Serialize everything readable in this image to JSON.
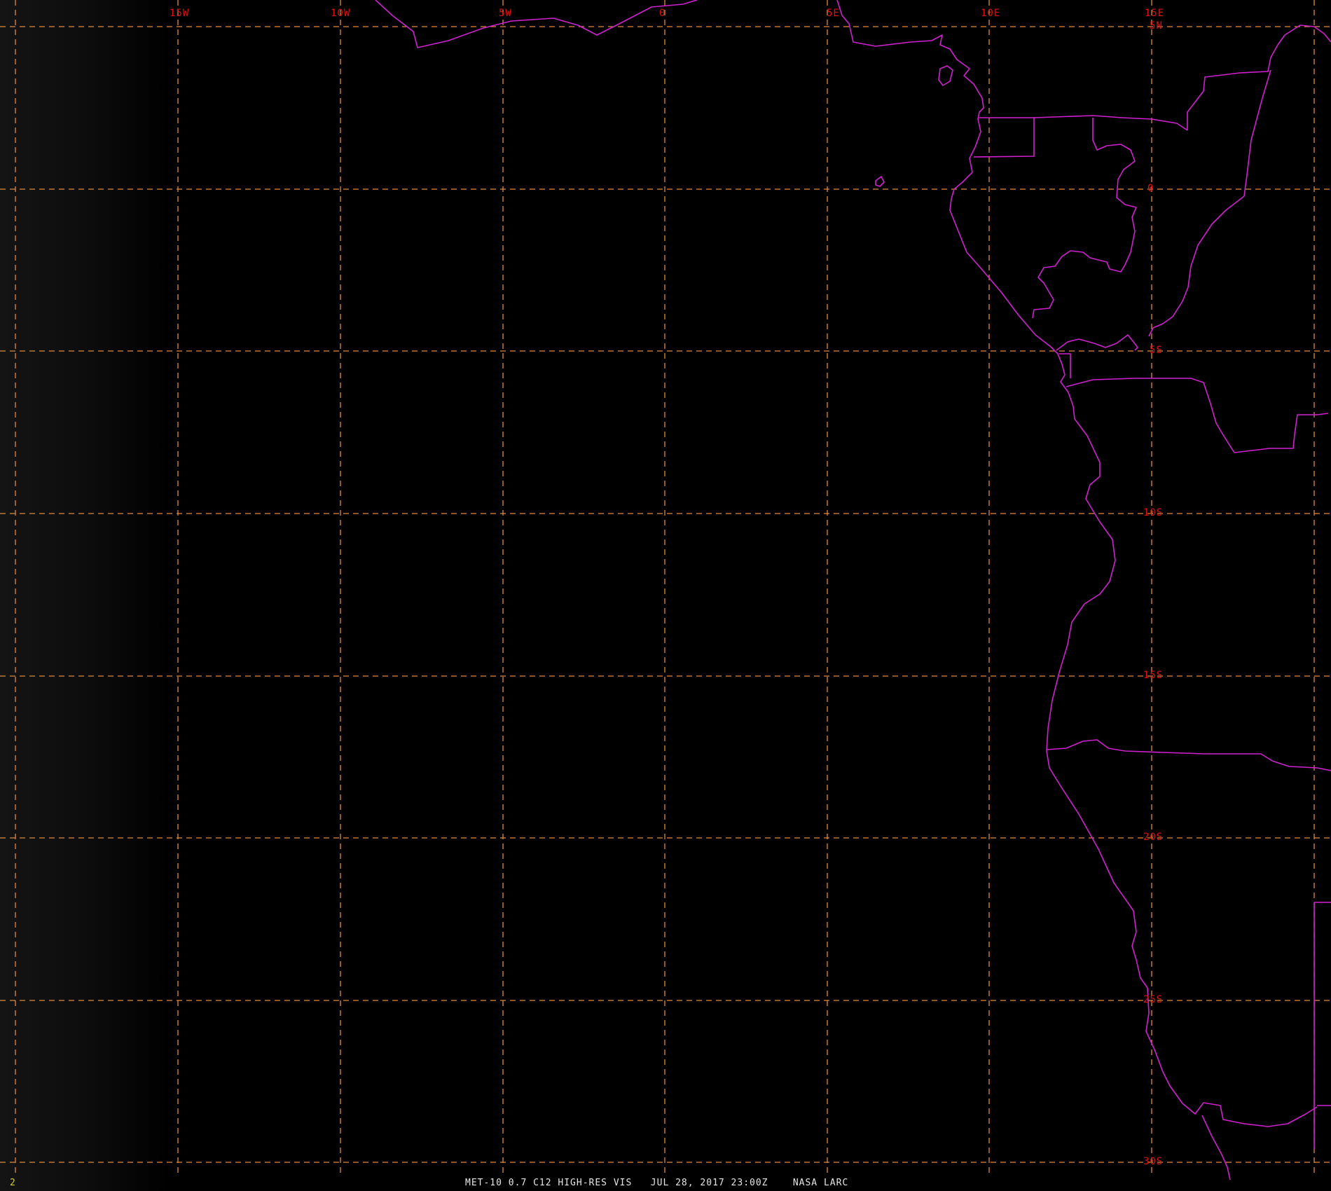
{
  "image": {
    "frame_number": "2",
    "caption": "MET-10 0.7 C12 HIGH-RES VIS   JUL 28, 2017 23:00Z    NASA LARC",
    "background": "#000000",
    "colors": {
      "grid": "#e08a40",
      "coastline": "#d020d0",
      "labels": "#e01010",
      "frame_number": "#d8d020"
    }
  },
  "longitude_labels": [
    "15W",
    "10W",
    "5W",
    "0",
    "5E",
    "10E",
    "15E"
  ],
  "latitude_labels": [
    "5N",
    "0",
    "5S",
    "10S",
    "15S",
    "20S",
    "25S",
    "30S"
  ]
}
